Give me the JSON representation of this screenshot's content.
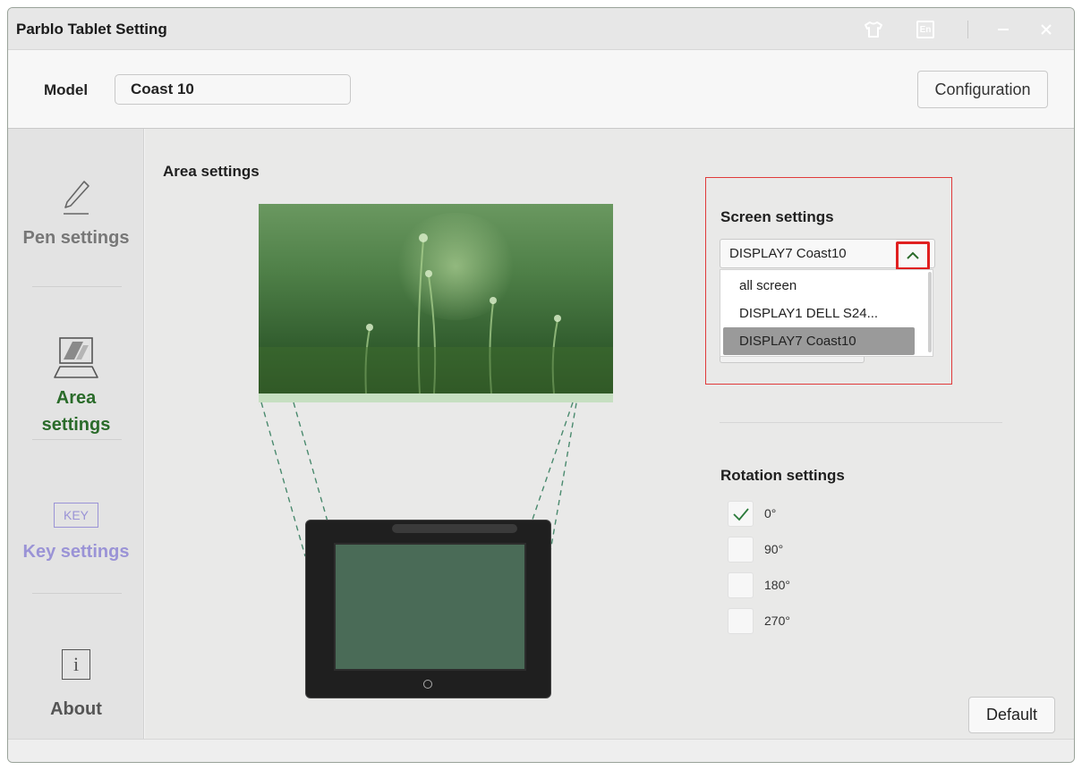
{
  "window": {
    "title": "Parblo Tablet Setting",
    "controls": [
      "theme-shirt-icon",
      "language-icon",
      "minimize-icon",
      "close-icon"
    ],
    "language_badge": "En"
  },
  "topbar": {
    "model_label": "Model",
    "model_value": "Coast 10",
    "configuration_label": "Configuration"
  },
  "sidebar": {
    "items": [
      {
        "label": "Pen settings",
        "icon": "pen-icon",
        "state": "normal"
      },
      {
        "label_line1": "Area",
        "label_line2": "settings",
        "icon": "area-icon",
        "state": "active"
      },
      {
        "label": "Key settings",
        "icon": "key-icon",
        "icon_text": "KEY",
        "state": "normal"
      },
      {
        "label": "About",
        "icon": "info-icon",
        "icon_text": "i",
        "state": "normal"
      }
    ]
  },
  "main": {
    "area_settings_title": "Area settings",
    "screen_settings": {
      "title": "Screen settings",
      "selected": "DISPLAY7 Coast10",
      "options": [
        "all screen",
        "DISPLAY1 DELL S24...",
        "DISPLAY7 Coast10"
      ],
      "selected_index": 2
    },
    "rotation_settings": {
      "title": "Rotation settings",
      "options": [
        {
          "label": "0°",
          "checked": true
        },
        {
          "label": "90°",
          "checked": false
        },
        {
          "label": "180°",
          "checked": false
        },
        {
          "label": "270°",
          "checked": false
        }
      ]
    },
    "default_label": "Default"
  },
  "colors": {
    "accent_green": "#2a6b2a",
    "highlight_red": "#e02020",
    "key_purple": "#9a93d6"
  }
}
